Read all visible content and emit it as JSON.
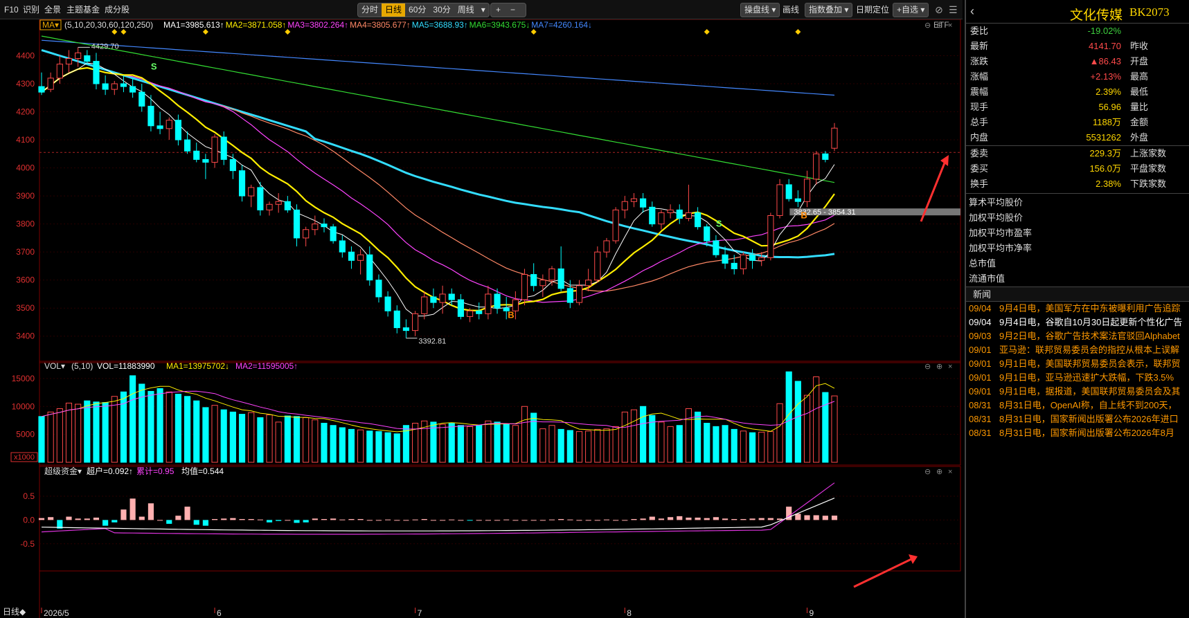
{
  "toolbar": {
    "left_items": [
      "F10",
      "识别",
      "全景",
      "主题基金",
      "成分股"
    ],
    "periods": [
      "分时",
      "日线",
      "60分",
      "30分",
      "周线"
    ],
    "active_period": "日线",
    "zoom_in": "+",
    "zoom_out": "−",
    "right_buttons": [
      "操盘线",
      "画线",
      "指数叠加",
      "日期定位",
      "+自选"
    ]
  },
  "ma_legend": {
    "selector": "MA",
    "params": "(5,10,20,30,60,120,250)",
    "items": [
      {
        "label": "MA1=3985.613",
        "color": "#ffffff",
        "arrow": "↑"
      },
      {
        "label": "MA2=3871.058",
        "color": "#ffee00",
        "arrow": "↑"
      },
      {
        "label": "MA3=3802.264",
        "color": "#ff44ff",
        "arrow": "↑"
      },
      {
        "label": "MA4=3805.677",
        "color": "#ff8866",
        "arrow": "↑"
      },
      {
        "label": "MA5=3688.93",
        "color": "#33ddff",
        "arrow": "↑"
      },
      {
        "label": "MA6=3943.675",
        "color": "#33dd33",
        "arrow": "↓"
      },
      {
        "label": "MA7=4260.164",
        "color": "#4488ff",
        "arrow": "↓"
      }
    ],
    "etf": "ETF"
  },
  "vol_legend": {
    "selector": "VOL",
    "params": "(5,10)",
    "vol": "VOL=11883990",
    "ma1": "MA1=13975702",
    "ma2": "MA2=11595005",
    "arrow_down": "↓",
    "arrow_up": "↑",
    "unit": "x1000"
  },
  "fund_legend": {
    "selector": "超级资金",
    "big": "超户=0.092",
    "cum": "累计=0.95",
    "avg": "均值=0.544",
    "arrow": "↑"
  },
  "annotations": {
    "high_label": "4429.70",
    "low_label": "3392.81",
    "range_label": "3832.65 - 3854.31",
    "sell_mark": "S",
    "buy_mark": "B"
  },
  "bottom_bar": {
    "period_label": "日线◆",
    "date_labels": [
      "2026/5",
      "6",
      "7",
      "8",
      "9"
    ]
  },
  "colors": {
    "up": "#ff4a4a",
    "down": "#00ffff",
    "yellow": "#ffd700",
    "grid": "#3a0000",
    "accent": "#e8a800"
  },
  "chart_data": {
    "type": "candlestick",
    "x": [
      "2026-05-06",
      "2026-05-07",
      "2026-05-08",
      "2026-05-11",
      "2026-05-12",
      "2026-05-13",
      "2026-05-14",
      "2026-05-15",
      "2026-05-18",
      "2026-05-19",
      "2026-05-20",
      "2026-05-21",
      "2026-05-22",
      "2026-05-25",
      "2026-05-26",
      "2026-05-27",
      "2026-05-28",
      "2026-05-29",
      "2026-06-01",
      "2026-06-02",
      "2026-06-03",
      "2026-06-04",
      "2026-06-05",
      "2026-06-08",
      "2026-06-09",
      "2026-06-10",
      "2026-06-11",
      "2026-06-12",
      "2026-06-15",
      "2026-06-16",
      "2026-06-17",
      "2026-06-18",
      "2026-06-19",
      "2026-06-22",
      "2026-06-23",
      "2026-06-24",
      "2026-06-25",
      "2026-06-26",
      "2026-06-29",
      "2026-06-30",
      "2026-07-01",
      "2026-07-02",
      "2026-07-03",
      "2026-07-06",
      "2026-07-07",
      "2026-07-08",
      "2026-07-09",
      "2026-07-10",
      "2026-07-13",
      "2026-07-14",
      "2026-07-15",
      "2026-07-16",
      "2026-07-17",
      "2026-07-20",
      "2026-07-21",
      "2026-07-22",
      "2026-07-23",
      "2026-07-24",
      "2026-07-27",
      "2026-07-28",
      "2026-07-29",
      "2026-07-30",
      "2026-07-31",
      "2026-08-03",
      "2026-08-04",
      "2026-08-05",
      "2026-08-06",
      "2026-08-07",
      "2026-08-10",
      "2026-08-11",
      "2026-08-12",
      "2026-08-13",
      "2026-08-14",
      "2026-08-17",
      "2026-08-18",
      "2026-08-19",
      "2026-08-20",
      "2026-08-21",
      "2026-08-24",
      "2026-08-25",
      "2026-08-26",
      "2026-08-27",
      "2026-08-28",
      "2026-08-31",
      "2026-09-01",
      "2026-09-02",
      "2026-09-03",
      "2026-09-04"
    ],
    "ohlc": [
      [
        4290,
        4340,
        4260,
        4270
      ],
      [
        4280,
        4340,
        4270,
        4320
      ],
      [
        4320,
        4400,
        4300,
        4370
      ],
      [
        4370,
        4420,
        4340,
        4390
      ],
      [
        4390,
        4429.7,
        4360,
        4410
      ],
      [
        4400,
        4420,
        4370,
        4380
      ],
      [
        4380,
        4410,
        4280,
        4300
      ],
      [
        4300,
        4330,
        4260,
        4280
      ],
      [
        4280,
        4310,
        4260,
        4300
      ],
      [
        4300,
        4330,
        4270,
        4290
      ],
      [
        4290,
        4320,
        4250,
        4270
      ],
      [
        4270,
        4300,
        4200,
        4220
      ],
      [
        4220,
        4260,
        4130,
        4150
      ],
      [
        4150,
        4200,
        4120,
        4140
      ],
      [
        4140,
        4180,
        4100,
        4170
      ],
      [
        4170,
        4190,
        4080,
        4100
      ],
      [
        4100,
        4130,
        4050,
        4060
      ],
      [
        4060,
        4090,
        4020,
        4030
      ],
      [
        4030,
        4050,
        3960,
        4020
      ],
      [
        4020,
        4120,
        4000,
        4110
      ],
      [
        4110,
        4130,
        4010,
        4030
      ],
      [
        4030,
        4050,
        3960,
        3990
      ],
      [
        3990,
        4010,
        3880,
        3900
      ],
      [
        3900,
        3940,
        3860,
        3930
      ],
      [
        3930,
        3950,
        3830,
        3850
      ],
      [
        3850,
        3880,
        3830,
        3870
      ],
      [
        3870,
        3910,
        3840,
        3880
      ],
      [
        3880,
        3900,
        3840,
        3850
      ],
      [
        3850,
        3870,
        3720,
        3750
      ],
      [
        3750,
        3790,
        3720,
        3780
      ],
      [
        3780,
        3830,
        3760,
        3800
      ],
      [
        3800,
        3820,
        3770,
        3790
      ],
      [
        3790,
        3800,
        3730,
        3740
      ],
      [
        3740,
        3760,
        3680,
        3700
      ],
      [
        3700,
        3720,
        3640,
        3670
      ],
      [
        3670,
        3710,
        3620,
        3690
      ],
      [
        3690,
        3720,
        3580,
        3600
      ],
      [
        3600,
        3620,
        3520,
        3540
      ],
      [
        3540,
        3560,
        3470,
        3490
      ],
      [
        3490,
        3510,
        3410,
        3430
      ],
      [
        3430,
        3460,
        3392.81,
        3420
      ],
      [
        3420,
        3490,
        3400,
        3480
      ],
      [
        3480,
        3560,
        3460,
        3540
      ],
      [
        3540,
        3570,
        3500,
        3520
      ],
      [
        3520,
        3580,
        3480,
        3550
      ],
      [
        3550,
        3570,
        3510,
        3530
      ],
      [
        3530,
        3550,
        3460,
        3470
      ],
      [
        3470,
        3500,
        3450,
        3490
      ],
      [
        3490,
        3520,
        3460,
        3480
      ],
      [
        3480,
        3580,
        3460,
        3550
      ],
      [
        3550,
        3570,
        3480,
        3500
      ],
      [
        3500,
        3540,
        3460,
        3490
      ],
      [
        3490,
        3560,
        3460,
        3530
      ],
      [
        3530,
        3640,
        3510,
        3620
      ],
      [
        3620,
        3660,
        3560,
        3580
      ],
      [
        3580,
        3620,
        3540,
        3600
      ],
      [
        3600,
        3650,
        3580,
        3640
      ],
      [
        3640,
        3720,
        3560,
        3570
      ],
      [
        3570,
        3600,
        3500,
        3520
      ],
      [
        3520,
        3600,
        3510,
        3580
      ],
      [
        3580,
        3640,
        3560,
        3600
      ],
      [
        3600,
        3720,
        3590,
        3700
      ],
      [
        3700,
        3750,
        3680,
        3740
      ],
      [
        3740,
        3860,
        3730,
        3850
      ],
      [
        3850,
        3900,
        3820,
        3880
      ],
      [
        3880,
        3910,
        3860,
        3890
      ],
      [
        3890,
        3910,
        3840,
        3860
      ],
      [
        3860,
        3880,
        3790,
        3800
      ],
      [
        3800,
        3850,
        3780,
        3840
      ],
      [
        3840,
        3870,
        3820,
        3850
      ],
      [
        3850,
        3870,
        3800,
        3820
      ],
      [
        3820,
        3940,
        3810,
        3840
      ],
      [
        3840,
        3860,
        3780,
        3790
      ],
      [
        3790,
        3800,
        3720,
        3740
      ],
      [
        3740,
        3760,
        3680,
        3690
      ],
      [
        3690,
        3720,
        3640,
        3660
      ],
      [
        3660,
        3690,
        3620,
        3640
      ],
      [
        3640,
        3700,
        3620,
        3690
      ],
      [
        3690,
        3710,
        3640,
        3670
      ],
      [
        3670,
        3700,
        3650,
        3680
      ],
      [
        3680,
        3840,
        3670,
        3830
      ],
      [
        3830,
        3960,
        3820,
        3940
      ],
      [
        3940,
        3960,
        3880,
        3890
      ],
      [
        3890,
        3920,
        3860,
        3880
      ],
      [
        3880,
        3990,
        3860,
        3960
      ],
      [
        3960,
        4060,
        3940,
        4050
      ],
      [
        4050,
        4060,
        4020,
        4030
      ],
      [
        4070,
        4160,
        4060,
        4141.7
      ]
    ],
    "volume": [
      8200,
      9000,
      9600,
      10600,
      10400,
      11000,
      10800,
      10700,
      11800,
      12600,
      15500,
      14000,
      12700,
      13200,
      12600,
      12200,
      11800,
      11000,
      9800,
      10200,
      9400,
      9000,
      8600,
      8900,
      8000,
      8500,
      7200,
      8300,
      8200,
      8000,
      7600,
      7000,
      6600,
      6200,
      5900,
      5800,
      5600,
      5500,
      5300,
      5100,
      6600,
      7000,
      7400,
      7200,
      6800,
      7000,
      6600,
      6400,
      6600,
      7400,
      7200,
      6800,
      6600,
      10000,
      8800,
      6000,
      6600,
      5900,
      5700,
      5500,
      5600,
      5900,
      6000,
      6400,
      9000,
      9400,
      10000,
      8400,
      7200,
      6400,
      6600,
      9600,
      9000,
      7000,
      6400,
      6600,
      5900,
      5600,
      5300,
      5400,
      5500,
      10500,
      16200,
      14500,
      12000,
      15300,
      12500,
      11884
    ],
    "fund_bars": [
      0.04,
      0.06,
      -0.18,
      0.07,
      0.03,
      0.03,
      0.05,
      -0.12,
      -0.05,
      0.22,
      0.45,
      0.07,
      0.35,
      0.0,
      -0.08,
      0.09,
      0.28,
      -0.1,
      -0.12,
      0.02,
      0.03,
      0.04,
      0.02,
      0.02,
      0.01,
      -0.05,
      -0.02,
      0.0,
      -0.06,
      -0.05,
      0.03,
      0.02,
      0.03,
      0.01,
      0.02,
      0.02,
      0.0,
      0.0,
      0.01,
      0.0,
      0.0,
      0.01,
      0.02,
      0.0,
      0.0,
      0.01,
      0.0,
      -0.01,
      0.0,
      0.0,
      0.0,
      0.01,
      0.0,
      0.0,
      0.0,
      0.0,
      0.01,
      0.02,
      0.01,
      0.0,
      0.0,
      0.0,
      0.01,
      0.0,
      0.0,
      0.02,
      0.03,
      0.07,
      0.03,
      0.06,
      0.08,
      0.05,
      0.05,
      0.04,
      0.06,
      0.03,
      0.02,
      0.02,
      0.03,
      0.04,
      0.04,
      0.03,
      0.28,
      0.13,
      0.1,
      0.1,
      0.09,
      0.092
    ],
    "ma_periods": [
      5,
      10,
      20,
      30,
      60,
      120,
      250
    ],
    "ylim": [
      3350,
      4490
    ],
    "ticks": [
      3400,
      3500,
      3600,
      3700,
      3800,
      3900,
      4000,
      4100,
      4200,
      4300,
      4400
    ],
    "vol_ticks": [
      5000,
      10000,
      15000
    ],
    "fund_ticks": [
      -0.5,
      0.0,
      0.5
    ],
    "fund_ylim": [
      -0.75,
      0.95
    ]
  },
  "side": {
    "title": "文化传媒",
    "code": "BK2073",
    "quotes": [
      {
        "l": "委比",
        "v": "-19.02%",
        "c": "green",
        "r": ""
      },
      {
        "l": "最新",
        "v": "4141.70",
        "c": "red",
        "r": "昨收"
      },
      {
        "l": "涨跌",
        "v": "▲86.43",
        "c": "red",
        "r": "开盘"
      },
      {
        "l": "涨幅",
        "v": "+2.13%",
        "c": "red",
        "r": "最高"
      },
      {
        "l": "震幅",
        "v": "2.39%",
        "c": "yel",
        "r": "最低"
      },
      {
        "l": "现手",
        "v": "56.96",
        "c": "yel",
        "r": "量比"
      },
      {
        "l": "总手",
        "v": "1188万",
        "c": "yel",
        "r": "金额"
      },
      {
        "l": "内盘",
        "v": "5531262",
        "c": "yel",
        "r": "外盘"
      },
      {
        "l": "委卖",
        "v": "229.3万",
        "c": "yel",
        "r": "上涨家数"
      },
      {
        "l": "委买",
        "v": "156.0万",
        "c": "yel",
        "r": "平盘家数"
      },
      {
        "l": "换手",
        "v": "2.38%",
        "c": "yel",
        "r": "下跌家数"
      }
    ],
    "details": [
      "算术平均股价",
      "加权平均股价",
      "加权平均市盈率",
      "加权平均市净率",
      "总市值",
      "流通市值"
    ],
    "news_title": "新闻",
    "news": [
      {
        "d": "09/04",
        "t": "9月4日电，美国军方在中东被曝利用广告追踪",
        "c": "#ff9900"
      },
      {
        "d": "09/04",
        "t": "9月4日电，谷歌自10月30日起更新个性化广告",
        "c": "#ffffff"
      },
      {
        "d": "09/03",
        "t": "9月2日电，谷歌广告技术案法官驳回Alphabet",
        "c": "#ff9900"
      },
      {
        "d": "09/01",
        "t": "亚马逊：联邦贸易委员会的指控从根本上误解",
        "c": "#ff9900"
      },
      {
        "d": "09/01",
        "t": "9月1日电，美国联邦贸易委员会表示，联邦贸",
        "c": "#ff9900"
      },
      {
        "d": "09/01",
        "t": "9月1日电，亚马逊迅速扩大跌幅，下跌3.5%",
        "c": "#ff9900"
      },
      {
        "d": "09/01",
        "t": "9月1日电，据报道，美国联邦贸易委员会及其",
        "c": "#ff9900"
      },
      {
        "d": "08/31",
        "t": "8月31日电，OpenAI称，自上线不到200天，",
        "c": "#ff9900"
      },
      {
        "d": "08/31",
        "t": "8月31日电，国家新闻出版署公布2026年进口",
        "c": "#ff9900"
      },
      {
        "d": "08/31",
        "t": "8月31日电，国家新闻出版署公布2026年8月",
        "c": "#ff9900"
      }
    ]
  }
}
